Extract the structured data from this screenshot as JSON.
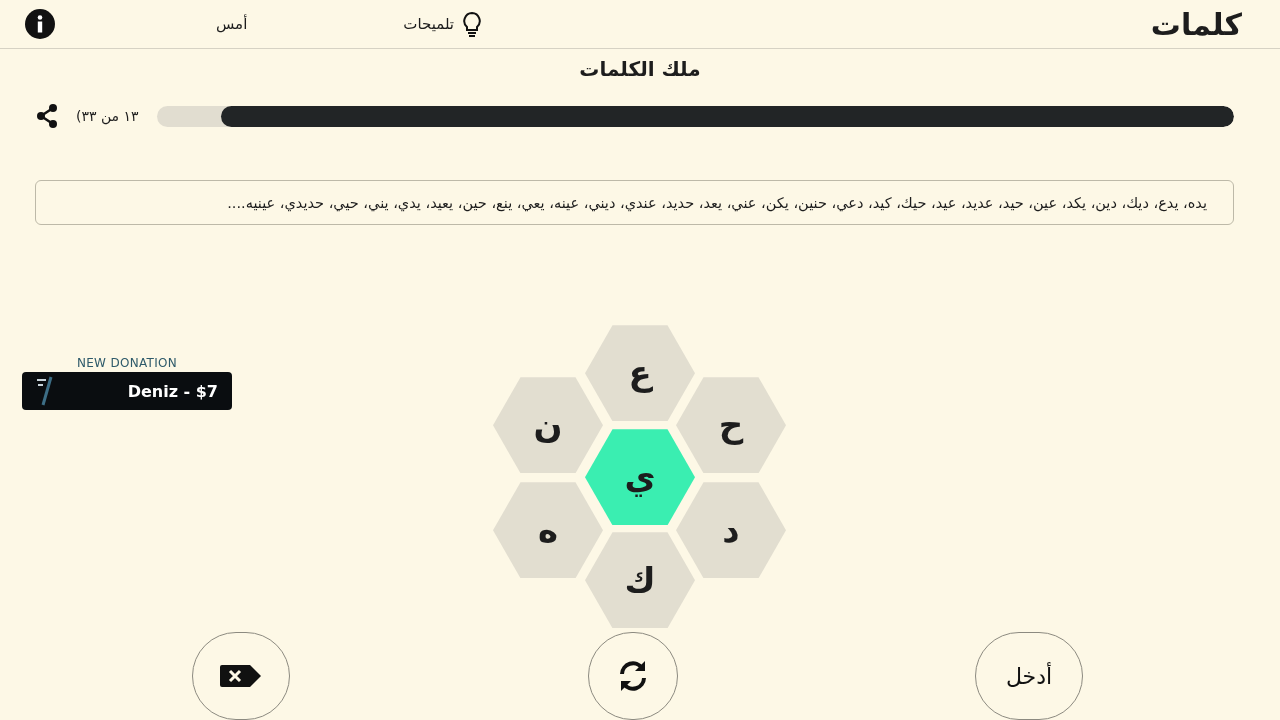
{
  "header": {
    "logo": "كلمات",
    "hints": "تلميحات",
    "yesterday": "أمس"
  },
  "rank": "ملك الكلمات",
  "progress": {
    "level": 0.94,
    "reading": "(١٣ من ٣٣"
  },
  "found_words": "يده، يدع، ديك، دين، يكد، عين، حيد، عديد، عيد، حيك، كيد، دعي، حنين، يكن، عني، يعد، حديد، عندي، ديني، عينه، يعي، ينع، حين، يعيد، يدي، يني، حيي، حديدي، عينيه....",
  "letters": [
    {
      "letter": "ع",
      "kind": "outer"
    },
    {
      "letter": "ن",
      "kind": "outer"
    },
    {
      "letter": "ح",
      "kind": "outer"
    },
    {
      "letter": "ي",
      "kind": "center"
    },
    {
      "letter": "ه",
      "kind": "outer"
    },
    {
      "letter": "د",
      "kind": "outer"
    },
    {
      "letter": "ك",
      "kind": "outer"
    }
  ],
  "donation": {
    "title": "NEW DONATION",
    "message": "Deniz - $7"
  },
  "buttons": {
    "enter": "أدخل"
  }
}
